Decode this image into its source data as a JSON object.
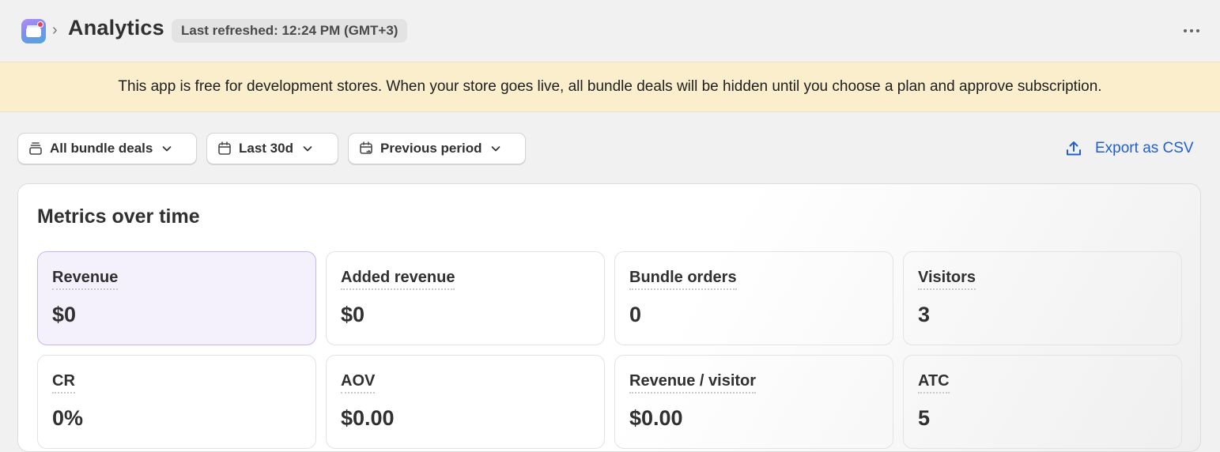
{
  "header": {
    "title": "Analytics",
    "breadcrumb_separator": "›",
    "refresh_badge": "Last refreshed: 12:24 PM (GMT+3)"
  },
  "banner": {
    "text": "This app is free for development stores. When your store goes live, all bundle deals will be hidden until you choose a plan and approve subscription."
  },
  "filters": {
    "bundle_filter": "All bundle deals",
    "date_range": "Last 30d",
    "comparison": "Previous period",
    "export_label": "Export as CSV"
  },
  "metrics_card": {
    "title": "Metrics over time",
    "metrics": [
      {
        "label": "Revenue",
        "value": "$0",
        "selected": true
      },
      {
        "label": "Added revenue",
        "value": "$0",
        "selected": false
      },
      {
        "label": "Bundle orders",
        "value": "0",
        "selected": false
      },
      {
        "label": "Visitors",
        "value": "3",
        "selected": false
      },
      {
        "label": "CR",
        "value": "0%",
        "selected": false
      },
      {
        "label": "AOV",
        "value": "$0.00",
        "selected": false
      },
      {
        "label": "Revenue / visitor",
        "value": "$0.00",
        "selected": false
      },
      {
        "label": "ATC",
        "value": "5",
        "selected": false
      }
    ]
  },
  "icons": {
    "app_logo": "bundle-app-logo",
    "more": "more-horizontal-icon",
    "bundle_filter": "stack-icon",
    "date_range": "calendar-icon",
    "comparison": "calendar-compare-icon",
    "export": "upload-icon"
  },
  "colors": {
    "banner_bg": "#faeecd",
    "link": "#1f5fd3",
    "selected_metric_bg": "#f4f1fd",
    "selected_metric_border": "#c8b6ee"
  }
}
